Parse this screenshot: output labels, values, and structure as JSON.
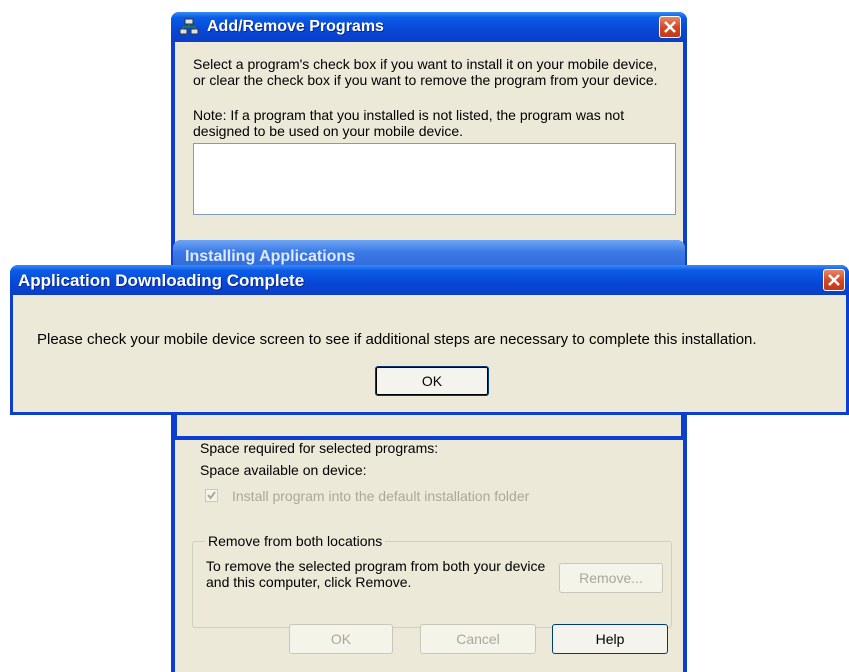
{
  "arp_window": {
    "title": "Add/Remove Programs",
    "intro_text": "Select a program's check box if you want to install it on your mobile device, or clear the check box if you want to remove the program from your device.",
    "note_text": "Note:  If a program that you installed is not listed, the program was not designed to be used on your mobile device.",
    "space_required_label": "Space required for selected programs:",
    "space_available_label": "Space available on device:",
    "install_default_folder_label": "Install program into the default installation folder",
    "install_default_folder_checked": true,
    "remove_group_label": "Remove from both locations",
    "remove_description": "To remove the selected program from both your device and this computer, click Remove.",
    "remove_button": "Remove...",
    "ok_button": "OK",
    "cancel_button": "Cancel",
    "help_button": "Help"
  },
  "installing_window": {
    "title": "Installing Applications"
  },
  "dialog": {
    "title": "Application Downloading Complete",
    "message": "Please check your mobile device screen to see if additional steps are necessary to complete this installation.",
    "ok_button": "OK"
  },
  "icons": [
    "app-icon",
    "close-icon"
  ],
  "colors": {
    "titlebar": "#0a5ce6",
    "window_bg": "#ece9d8",
    "close_button": "#d4451f"
  }
}
